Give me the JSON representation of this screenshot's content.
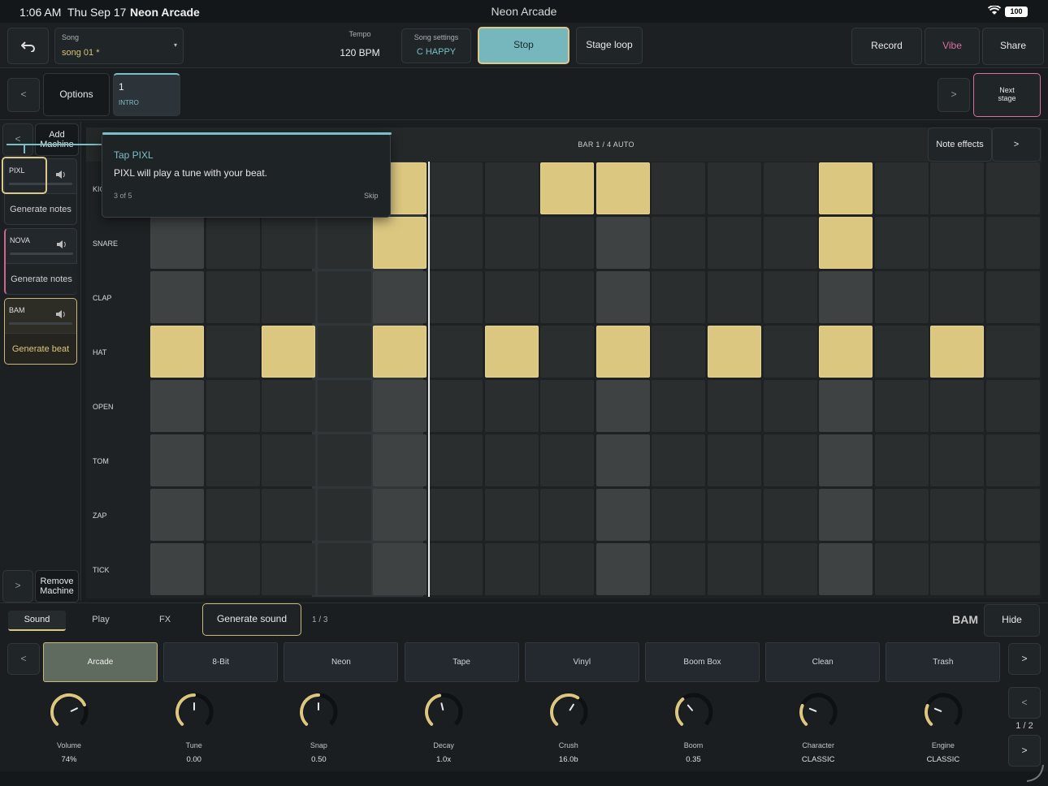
{
  "status": {
    "time": "1:06 AM",
    "date": "Thu Sep 17",
    "app_bold": "Neon Arcade",
    "center_title": "Neon Arcade",
    "battery": "100"
  },
  "topbar": {
    "song_label": "Song",
    "song_value": "song 01 *",
    "tempo_label": "Tempo",
    "tempo_value": "120 BPM",
    "settings_label": "Song settings",
    "settings_value": "C HAPPY",
    "stop": "Stop",
    "stage_loop": "Stage loop",
    "record": "Record",
    "vibe": "Vibe",
    "share": "Share"
  },
  "stagebar": {
    "prev": "<",
    "options": "Options",
    "stage_number": "1",
    "stage_name": "INTRO",
    "next": ">",
    "next_stage": "Next stage"
  },
  "sidebar": {
    "prev": "<",
    "add_machine": "Add Machine",
    "next": ">",
    "remove_machine": "Remove Machine",
    "machines": [
      {
        "name": "PIXL",
        "action": "Generate notes"
      },
      {
        "name": "NOVA",
        "action": "Generate notes"
      },
      {
        "name": "BAM",
        "action": "Generate beat"
      }
    ]
  },
  "grid": {
    "bar_info": "BAR 1 / 4  AUTO",
    "note_effects": "Note effects",
    "next": ">",
    "rows": [
      "KICK",
      "SNARE",
      "CLAP",
      "HAT",
      "OPEN",
      "TOM",
      "ZAP",
      "TICK"
    ],
    "kick_visible": "KIC",
    "active": {
      "KICK": [
        4,
        7,
        8,
        12
      ],
      "SNARE": [
        4,
        12
      ],
      "HAT": [
        0,
        2,
        4,
        6,
        8,
        10,
        12,
        14
      ]
    },
    "playhead_step": 5
  },
  "tooltip": {
    "title": "Tap PIXL",
    "body": "PIXL will play a tune with your beat.",
    "progress": "3 of 5",
    "skip": "Skip"
  },
  "bottom": {
    "tabs": [
      "Sound",
      "Play",
      "FX"
    ],
    "generate_sound": "Generate sound",
    "page": "1 / 3",
    "machine": "BAM",
    "hide": "Hide",
    "prev": "<",
    "next": ">",
    "presets": [
      "Arcade",
      "8-Bit",
      "Neon",
      "Tape",
      "Vinyl",
      "Boom Box",
      "Clean",
      "Trash"
    ],
    "knob_page": "1 / 2",
    "knobs": [
      {
        "label": "Volume",
        "value": "74%",
        "level": 0.74
      },
      {
        "label": "Tune",
        "value": "0.00",
        "level": 0.5
      },
      {
        "label": "Snap",
        "value": "0.50",
        "level": 0.5
      },
      {
        "label": "Decay",
        "value": "1.0x",
        "level": 0.45
      },
      {
        "label": "Crush",
        "value": "16.0b",
        "level": 0.62
      },
      {
        "label": "Boom",
        "value": "0.35",
        "level": 0.35
      },
      {
        "label": "Character",
        "value": "CLASSIC",
        "level": 0.25
      },
      {
        "label": "Engine",
        "value": "CLASSIC",
        "level": 0.25
      }
    ]
  },
  "colors": {
    "accent_yellow": "#dcc780",
    "accent_teal": "#7bbfc6",
    "vibe_pink": "#d86fa0"
  }
}
